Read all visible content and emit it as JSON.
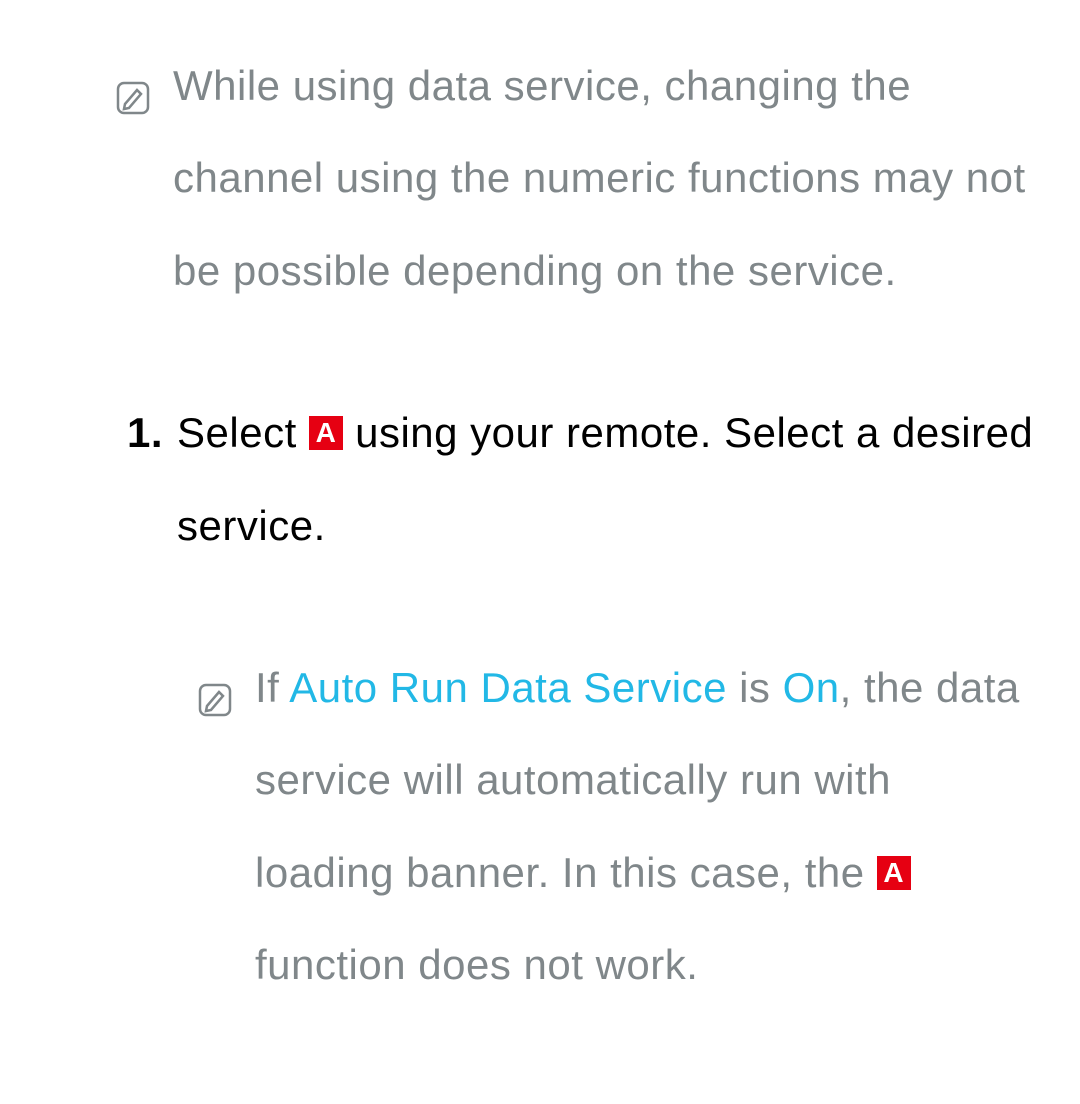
{
  "note1": {
    "text": "While using data service, changing the channel using the numeric functions may not be possible depending on the service."
  },
  "step1": {
    "number": "1.",
    "text_before": "Select ",
    "badge": "A",
    "text_after": " using your remote. Select a desired service."
  },
  "note2": {
    "text_before": "If ",
    "highlight1": "Auto Run Data Service",
    "text_mid1": " is ",
    "highlight2": "On",
    "text_mid2": ", the data service will automatically run with loading banner. In this case, the ",
    "badge": "A",
    "text_after": " function does not work."
  }
}
